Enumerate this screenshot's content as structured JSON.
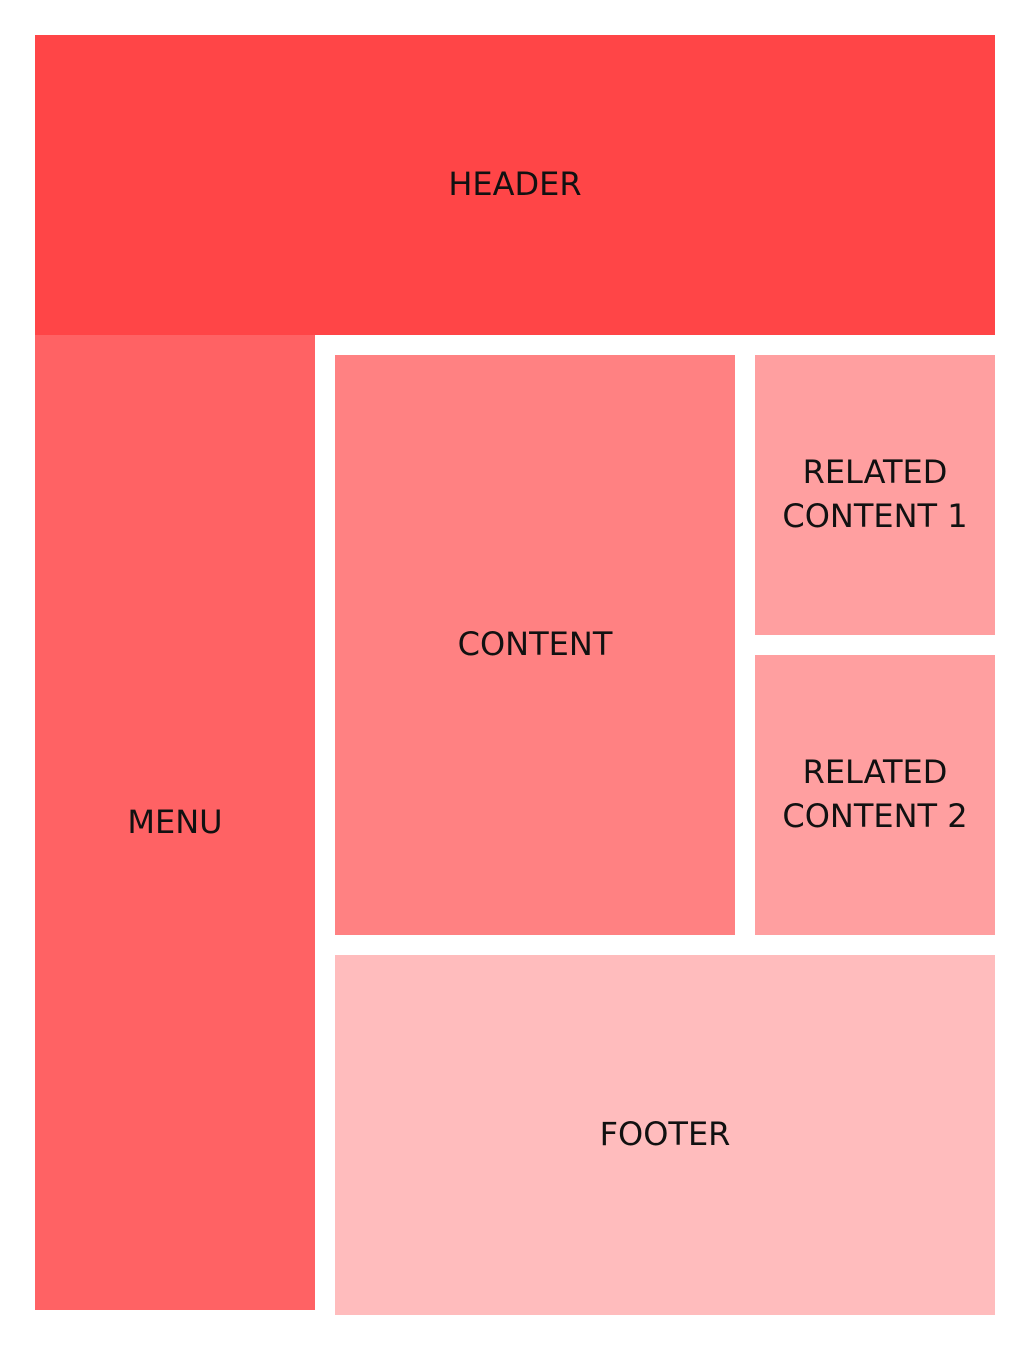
{
  "header": {
    "label": "HEADER",
    "color": "#ff4547"
  },
  "menu": {
    "label": "MENU",
    "color": "#ff6264"
  },
  "content": {
    "label": "CONTENT",
    "color": "#ff8182"
  },
  "related_1": {
    "line1": "RELATED",
    "line2": "CONTENT 1",
    "color": "#ff9fa0"
  },
  "related_2": {
    "line1": "RELATED",
    "line2": "CONTENT 2",
    "color": "#ff9fa0"
  },
  "footer": {
    "label": "FOOTER",
    "color": "#ffbcbd"
  }
}
